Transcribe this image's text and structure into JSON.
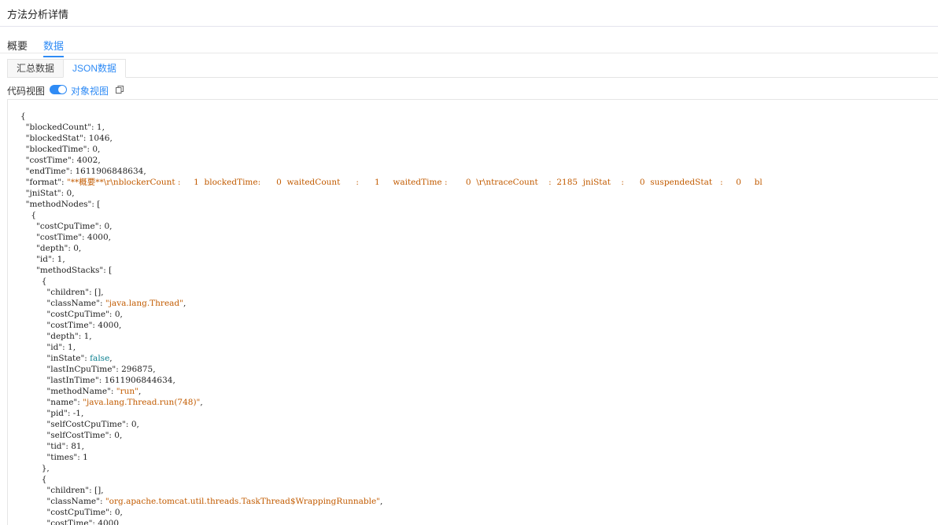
{
  "header": {
    "title": "方法分析详情"
  },
  "main_tabs": [
    {
      "label": "概要"
    },
    {
      "label": "数据"
    }
  ],
  "sub_tabs": [
    {
      "label": "汇总数据"
    },
    {
      "label": "JSON数据"
    }
  ],
  "view": {
    "code_view_label": "代码视图",
    "object_view_label": "对象视图"
  },
  "colors": {
    "accent": "#2f8bf5",
    "string": "#c25b00",
    "boolean": "#0a7f8f"
  },
  "code_lines": [
    [
      [
        "p",
        "{"
      ]
    ],
    [
      [
        "p",
        "  \""
      ],
      [
        "k",
        "blockedCount"
      ],
      [
        "p",
        "\": "
      ],
      [
        "n",
        "1"
      ],
      [
        "p",
        ","
      ]
    ],
    [
      [
        "p",
        "  \""
      ],
      [
        "k",
        "blockedStat"
      ],
      [
        "p",
        "\": "
      ],
      [
        "n",
        "1046"
      ],
      [
        "p",
        ","
      ]
    ],
    [
      [
        "p",
        "  \""
      ],
      [
        "k",
        "blockedTime"
      ],
      [
        "p",
        "\": "
      ],
      [
        "n",
        "0"
      ],
      [
        "p",
        ","
      ]
    ],
    [
      [
        "p",
        "  \""
      ],
      [
        "k",
        "costTime"
      ],
      [
        "p",
        "\": "
      ],
      [
        "n",
        "4002"
      ],
      [
        "p",
        ","
      ]
    ],
    [
      [
        "p",
        "  \""
      ],
      [
        "k",
        "endTime"
      ],
      [
        "p",
        "\": "
      ],
      [
        "n",
        "1611906848634"
      ],
      [
        "p",
        ","
      ]
    ],
    [
      [
        "p",
        "  \""
      ],
      [
        "k",
        "format"
      ],
      [
        "p",
        "\": "
      ],
      [
        "s",
        "\"**概要**\\r\\nblockerCount :     1  blockedTime:      0  waitedCount      :      1     waitedTime :       0  \\r\\ntraceCount    :  2185  jniStat    :      0  suspendedStat   :     0     bl"
      ]
    ],
    [
      [
        "p",
        "  \""
      ],
      [
        "k",
        "jniStat"
      ],
      [
        "p",
        "\": "
      ],
      [
        "n",
        "0"
      ],
      [
        "p",
        ","
      ]
    ],
    [
      [
        "p",
        "  \""
      ],
      [
        "k",
        "methodNodes"
      ],
      [
        "p",
        "\": ["
      ]
    ],
    [
      [
        "p",
        "    {"
      ]
    ],
    [
      [
        "p",
        "      \""
      ],
      [
        "k",
        "costCpuTime"
      ],
      [
        "p",
        "\": "
      ],
      [
        "n",
        "0"
      ],
      [
        "p",
        ","
      ]
    ],
    [
      [
        "p",
        "      \""
      ],
      [
        "k",
        "costTime"
      ],
      [
        "p",
        "\": "
      ],
      [
        "n",
        "4000"
      ],
      [
        "p",
        ","
      ]
    ],
    [
      [
        "p",
        "      \""
      ],
      [
        "k",
        "depth"
      ],
      [
        "p",
        "\": "
      ],
      [
        "n",
        "0"
      ],
      [
        "p",
        ","
      ]
    ],
    [
      [
        "p",
        "      \""
      ],
      [
        "k",
        "id"
      ],
      [
        "p",
        "\": "
      ],
      [
        "n",
        "1"
      ],
      [
        "p",
        ","
      ]
    ],
    [
      [
        "p",
        "      \""
      ],
      [
        "k",
        "methodStacks"
      ],
      [
        "p",
        "\": ["
      ]
    ],
    [
      [
        "p",
        "        {"
      ]
    ],
    [
      [
        "p",
        "          \""
      ],
      [
        "k",
        "children"
      ],
      [
        "p",
        "\": [],"
      ]
    ],
    [
      [
        "p",
        "          \""
      ],
      [
        "k",
        "className"
      ],
      [
        "p",
        "\": "
      ],
      [
        "s",
        "\"java.lang.Thread\""
      ],
      [
        "p",
        ","
      ]
    ],
    [
      [
        "p",
        "          \""
      ],
      [
        "k",
        "costCpuTime"
      ],
      [
        "p",
        "\": "
      ],
      [
        "n",
        "0"
      ],
      [
        "p",
        ","
      ]
    ],
    [
      [
        "p",
        "          \""
      ],
      [
        "k",
        "costTime"
      ],
      [
        "p",
        "\": "
      ],
      [
        "n",
        "4000"
      ],
      [
        "p",
        ","
      ]
    ],
    [
      [
        "p",
        "          \""
      ],
      [
        "k",
        "depth"
      ],
      [
        "p",
        "\": "
      ],
      [
        "n",
        "1"
      ],
      [
        "p",
        ","
      ]
    ],
    [
      [
        "p",
        "          \""
      ],
      [
        "k",
        "id"
      ],
      [
        "p",
        "\": "
      ],
      [
        "n",
        "1"
      ],
      [
        "p",
        ","
      ]
    ],
    [
      [
        "p",
        "          \""
      ],
      [
        "k",
        "inState"
      ],
      [
        "p",
        "\": "
      ],
      [
        "b",
        "false"
      ],
      [
        "p",
        ","
      ]
    ],
    [
      [
        "p",
        "          \""
      ],
      [
        "k",
        "lastInCpuTime"
      ],
      [
        "p",
        "\": "
      ],
      [
        "n",
        "296875"
      ],
      [
        "p",
        ","
      ]
    ],
    [
      [
        "p",
        "          \""
      ],
      [
        "k",
        "lastInTime"
      ],
      [
        "p",
        "\": "
      ],
      [
        "n",
        "1611906844634"
      ],
      [
        "p",
        ","
      ]
    ],
    [
      [
        "p",
        "          \""
      ],
      [
        "k",
        "methodName"
      ],
      [
        "p",
        "\": "
      ],
      [
        "s",
        "\"run\""
      ],
      [
        "p",
        ","
      ]
    ],
    [
      [
        "p",
        "          \""
      ],
      [
        "k",
        "name"
      ],
      [
        "p",
        "\": "
      ],
      [
        "s",
        "\"java.lang.Thread.run(748)\""
      ],
      [
        "p",
        ","
      ]
    ],
    [
      [
        "p",
        "          \""
      ],
      [
        "k",
        "pid"
      ],
      [
        "p",
        "\": "
      ],
      [
        "n",
        "-1"
      ],
      [
        "p",
        ","
      ]
    ],
    [
      [
        "p",
        "          \""
      ],
      [
        "k",
        "selfCostCpuTime"
      ],
      [
        "p",
        "\": "
      ],
      [
        "n",
        "0"
      ],
      [
        "p",
        ","
      ]
    ],
    [
      [
        "p",
        "          \""
      ],
      [
        "k",
        "selfCostTime"
      ],
      [
        "p",
        "\": "
      ],
      [
        "n",
        "0"
      ],
      [
        "p",
        ","
      ]
    ],
    [
      [
        "p",
        "          \""
      ],
      [
        "k",
        "tid"
      ],
      [
        "p",
        "\": "
      ],
      [
        "n",
        "81"
      ],
      [
        "p",
        ","
      ]
    ],
    [
      [
        "p",
        "          \""
      ],
      [
        "k",
        "times"
      ],
      [
        "p",
        "\": "
      ],
      [
        "n",
        "1"
      ]
    ],
    [
      [
        "p",
        "        },"
      ]
    ],
    [
      [
        "p",
        "        {"
      ]
    ],
    [
      [
        "p",
        "          \""
      ],
      [
        "k",
        "children"
      ],
      [
        "p",
        "\": [],"
      ]
    ],
    [
      [
        "p",
        "          \""
      ],
      [
        "k",
        "className"
      ],
      [
        "p",
        "\": "
      ],
      [
        "s",
        "\"org.apache.tomcat.util.threads.TaskThread$WrappingRunnable\""
      ],
      [
        "p",
        ","
      ]
    ],
    [
      [
        "p",
        "          \""
      ],
      [
        "k",
        "costCpuTime"
      ],
      [
        "p",
        "\": "
      ],
      [
        "n",
        "0"
      ],
      [
        "p",
        ","
      ]
    ],
    [
      [
        "p",
        "          \""
      ],
      [
        "k",
        "costTime"
      ],
      [
        "p",
        "\": "
      ],
      [
        "n",
        "4000"
      ],
      [
        "p",
        ","
      ]
    ]
  ]
}
